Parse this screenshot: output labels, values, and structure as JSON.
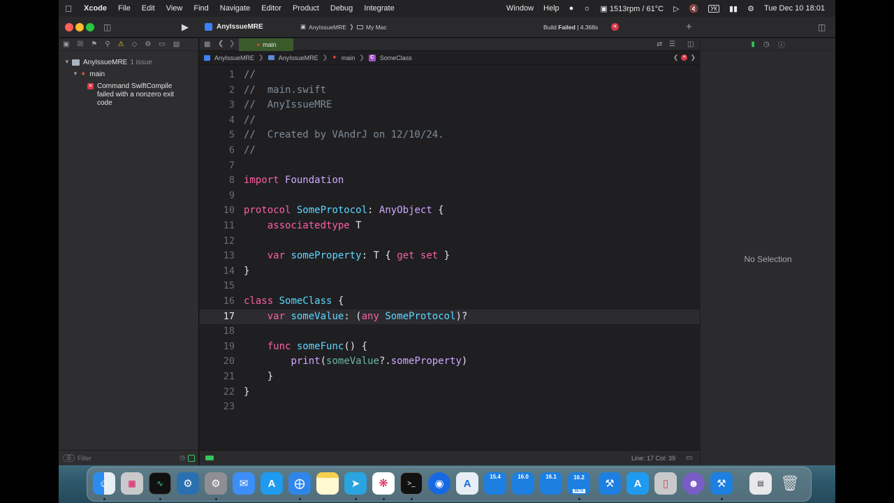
{
  "menubar": {
    "app": "Xcode",
    "items": [
      "File",
      "Edit",
      "View",
      "Find",
      "Navigate",
      "Editor",
      "Product",
      "Debug",
      "Integrate"
    ],
    "right_items": [
      "Window",
      "Help"
    ],
    "fan": "1513rpm / 61°C",
    "keyboard": "УК",
    "clock": "Tue Dec 10  18:01"
  },
  "titlebar": {
    "project": "AnyIssueMRE",
    "scheme": "AnyIssueMRE",
    "destination": "My Mac",
    "build_status_label": "Build",
    "build_status_value": "Failed",
    "build_time": "| 4.368s"
  },
  "navigator": {
    "project": "AnyIssueMRE",
    "issue_count": "1 issue",
    "group": "main",
    "issue_text_1": "Command SwiftCompile",
    "issue_text_2": "failed with a nonzero exit",
    "issue_text_3": "code",
    "filter_placeholder": "Filter"
  },
  "editor": {
    "tab": "main",
    "breadcrumb": [
      "AnyIssueMRE",
      "AnyIssueMRE",
      "main",
      "SomeClass"
    ],
    "status": "Line: 17  Col: 39",
    "code_lines": [
      "//",
      "//  main.swift",
      "//  AnyIssueMRE",
      "//",
      "//  Created by VAndrJ on 12/10/24.",
      "//",
      "",
      "import Foundation",
      "",
      "protocol SomeProtocol: AnyObject {",
      "    associatedtype T",
      "",
      "    var someProperty: T { get set }",
      "}",
      "",
      "class SomeClass {",
      "    var someValue: (any SomeProtocol)?",
      "",
      "    func someFunc() {",
      "        print(someValue?.someProperty)",
      "    }",
      "}",
      ""
    ],
    "current_line": 17
  },
  "inspector": {
    "empty_text": "No Selection"
  },
  "dock": {
    "items": [
      "finder-icon",
      "launchpad-icon",
      "activity-monitor-icon",
      "settings-icon",
      "system-preferences-icon",
      "mail-icon",
      "app-store-icon",
      "safari-icon",
      "notes-icon",
      "telegram-icon",
      "slack-icon",
      "terminal-icon",
      "proxyman-icon",
      "instruments-icon",
      "xcode-15-4-icon",
      "xcode-16-0-icon",
      "xcode-16-1-icon",
      "xcode-16-2-icon",
      "xcode-icon",
      "app-store-connect-icon",
      "simulator-icon",
      "ghost-icon",
      "xcode-alt-icon",
      "preview-icon",
      "trash-icon"
    ],
    "xcode_badges": [
      "15.4",
      "16.0",
      "16.1",
      "16.2"
    ],
    "beta_badge": "BETA"
  }
}
